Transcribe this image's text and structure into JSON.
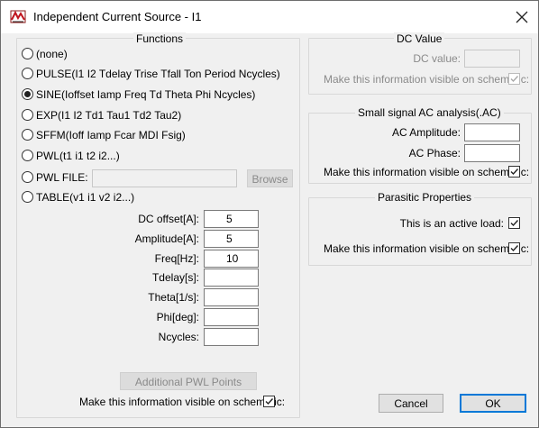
{
  "window": {
    "title": "Independent Current Source - I1"
  },
  "functions": {
    "title": "Functions",
    "options": [
      {
        "label": "(none)",
        "checked": false
      },
      {
        "label": "PULSE(I1 I2 Tdelay Trise Tfall Ton Period Ncycles)",
        "checked": false
      },
      {
        "label": "SINE(Ioffset Iamp Freq Td Theta Phi Ncycles)",
        "checked": true
      },
      {
        "label": "EXP(I1 I2 Td1 Tau1 Td2 Tau2)",
        "checked": false
      },
      {
        "label": "SFFM(Ioff Iamp Fcar MDI Fsig)",
        "checked": false
      },
      {
        "label": "PWL(t1 i1 t2 i2...)",
        "checked": false
      },
      {
        "label": "PWL FILE:",
        "checked": false
      },
      {
        "label": "TABLE(v1 i1 v2 i2...)",
        "checked": false
      }
    ],
    "pwl_file_value": "",
    "browse_label": "Browse",
    "params": [
      {
        "label": "DC offset[A]:",
        "value": "5"
      },
      {
        "label": "Amplitude[A]:",
        "value": "5"
      },
      {
        "label": "Freq[Hz]:",
        "value": "10"
      },
      {
        "label": "Tdelay[s]:",
        "value": ""
      },
      {
        "label": "Theta[1/s]:",
        "value": ""
      },
      {
        "label": "Phi[deg]:",
        "value": ""
      },
      {
        "label": "Ncycles:",
        "value": ""
      }
    ],
    "additional_pwl_label": "Additional PWL Points"
  },
  "visible_on_schematic_label": "Make this information visible on schematic:",
  "visible_on_schematic_checked": true,
  "dc_value": {
    "title": "DC Value",
    "label": "DC value:",
    "value": "",
    "visible_label": "Make this information visible on schematic:",
    "visible_checked": true
  },
  "ac_analysis": {
    "title": "Small signal AC analysis(.AC)",
    "amplitude_label": "AC Amplitude:",
    "amplitude_value": "",
    "phase_label": "AC Phase:",
    "phase_value": "",
    "visible_label": "Make this information visible on schematic:",
    "visible_checked": true
  },
  "parasitic": {
    "title": "Parasitic Properties",
    "active_load_label": "This is an active load:",
    "active_load_checked": true,
    "visible_label": "Make this information visible on schematic:",
    "visible_checked": true
  },
  "buttons": {
    "cancel": "Cancel",
    "ok": "OK"
  }
}
